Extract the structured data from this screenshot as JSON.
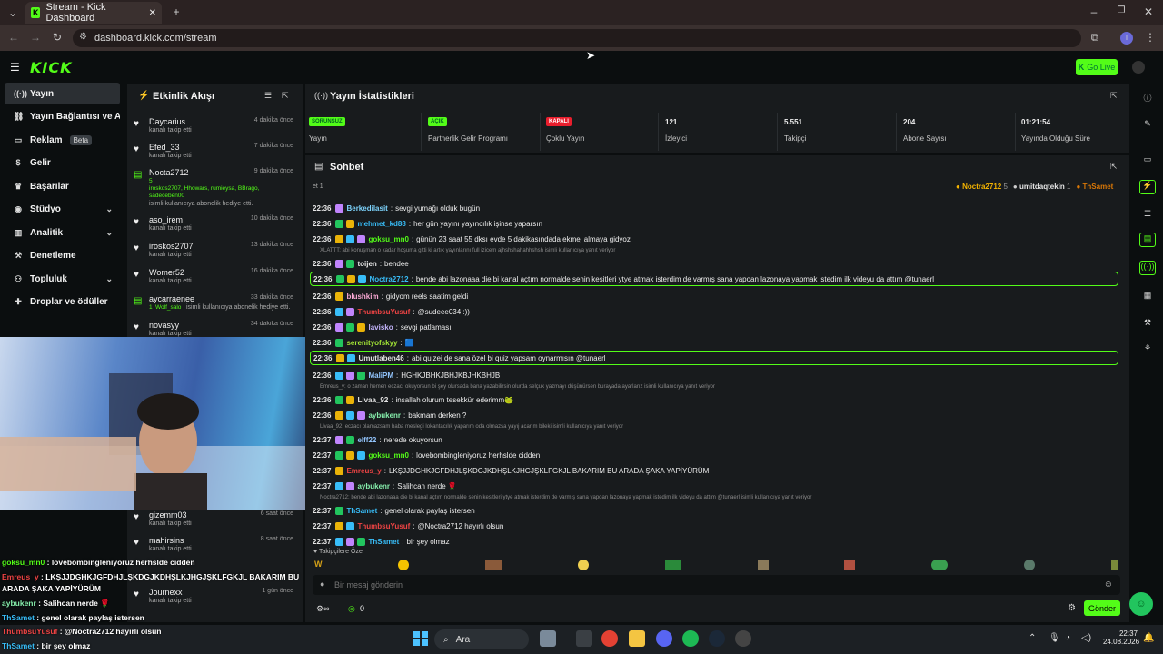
{
  "browser": {
    "tab_title": "Stream - Kick Dashboard",
    "url": "dashboard.kick.com/stream"
  },
  "header": {
    "logo": "KICK",
    "go_live": "Go Live"
  },
  "sidebar": {
    "items": [
      {
        "label": "Yayın",
        "icon": "stream-icon"
      },
      {
        "label": "Yayın Bağlantısı ve Anahtarı",
        "icon": "link-icon"
      },
      {
        "label": "Reklam",
        "badge": "Beta",
        "icon": "tv-icon"
      },
      {
        "label": "Gelir",
        "icon": "dollar-icon"
      },
      {
        "label": "Başarılar",
        "icon": "trophy-icon"
      },
      {
        "label": "Stüdyo",
        "icon": "studio-icon"
      },
      {
        "label": "Analitik",
        "icon": "chart-icon"
      },
      {
        "label": "Denetleme",
        "icon": "gavel-icon"
      },
      {
        "label": "Topluluk",
        "icon": "users-icon"
      },
      {
        "label": "Droplar ve ödüller",
        "icon": "gift-icon"
      }
    ]
  },
  "activity": {
    "title": "Etkinlik Akışı",
    "items": [
      {
        "name": "Daycarius",
        "time": "4 dakika önce",
        "desc": "kanalı takip etti"
      },
      {
        "name": "Efed_33",
        "time": "7 dakika önce",
        "desc": "kanalı takip etti"
      },
      {
        "name": "Nocta2712",
        "time": "9 dakika önce",
        "gift_count": "5",
        "gift_names": "iroskos2707, Hhowars, rumieysa, BBrago, sadeceben00",
        "desc": "isimli kullanıcıya abonelik hediye etti."
      },
      {
        "name": "aso_irem",
        "time": "10 dakika önce",
        "desc": "kanalı takip etti"
      },
      {
        "name": "iroskos2707",
        "time": "13 dakika önce",
        "desc": "kanalı takip etti"
      },
      {
        "name": "Womer52",
        "time": "16 dakika önce",
        "desc": "kanalı takip etti"
      },
      {
        "name": "aycarraenee",
        "time": "33 dakika önce",
        "gift_count": "1",
        "gift_names": "Wolf_salo",
        "desc": "isimli kullanıcıya abonelik hediye etti."
      },
      {
        "name": "novasyy",
        "time": "34 dakika önce",
        "desc": "kanalı takip etti"
      },
      {
        "name": "gizemm03",
        "time": "6 saat önce",
        "desc": "kanalı takip etti"
      },
      {
        "name": "mahirsins",
        "time": "8 saat önce",
        "desc": "kanalı takip etti"
      },
      {
        "name": "Journexx",
        "time": "1 gün önce",
        "desc": "kanalı takip etti"
      }
    ]
  },
  "stats": {
    "title": "Yayın İstatistikleri",
    "cells": [
      {
        "badge": "SORUNSUZ",
        "badge_color": "#53fc18",
        "label": "Yayın"
      },
      {
        "badge": "AÇIK",
        "badge_color": "#53fc18",
        "label": "Partnerlik Gelir Programı"
      },
      {
        "badge": "KAPALI",
        "badge_color": "#e91e2d",
        "label": "Çoklu Yayın"
      },
      {
        "value": "121",
        "label": "İzleyici"
      },
      {
        "value": "5.551",
        "label": "Takipçi"
      },
      {
        "value": "204",
        "label": "Abone Sayısı"
      },
      {
        "value": "01:21:54",
        "label": "Yayında Olduğu Süre"
      }
    ]
  },
  "chat": {
    "title": "Sohbet",
    "top_gifters": [
      {
        "name": "Noctra2712",
        "count": "5"
      },
      {
        "name": "umitdaqtekin",
        "count": "1"
      },
      {
        "name": "ThSamet",
        "count": ""
      }
    ],
    "top_left": "et 1",
    "messages": [
      {
        "time": "22:36",
        "user": "Berkedilasit",
        "color": "#7dd3fc",
        "text": "sevgi yumağı olduk bugün"
      },
      {
        "time": "22:36",
        "user": "mehmet_kd88",
        "color": "#38bdf8",
        "text": "her gün yayını yayıncılık işinse yaparsın"
      },
      {
        "time": "22:36",
        "user": "goksu_mn0",
        "color": "#53fc18",
        "text": "günün 23 saat 55 dksı evde 5 dakikasındada ekmej almaya gidyoz"
      },
      {
        "reply": "XLATTT: abi konuşman o kadar hoşuma gitti ki artık yayınlarını full izicem ajhshshahahhshsh isimli kullanıcıya yanıt veriyor"
      },
      {
        "time": "22:36",
        "user": "toijen",
        "color": "#e5e5e5",
        "text": "bendee"
      },
      {
        "time": "22:36",
        "user": "Noctra2712",
        "color": "#38bdf8",
        "text": "bende abi lazonaaa die bi kanal açtım normalde senin kesitleri ytye atmak isterdim de varmış sana yapoan lazonaya yapmak istedim ilk videyu da attım @tunaerl",
        "highlight": true
      },
      {
        "time": "22:36",
        "user": "blushkim",
        "color": "#f9a8d4",
        "text": "gidyom reels saatim geldi"
      },
      {
        "time": "22:36",
        "user": "ThumbsuYusuf",
        "color": "#ef4444",
        "text": "@sudeee034 :))"
      },
      {
        "time": "22:36",
        "user": "lavisko",
        "color": "#c4b5fd",
        "text": "sevgi patlaması"
      },
      {
        "time": "22:36",
        "user": "serenityofskyy",
        "color": "#a3e635",
        "text": "🟦"
      },
      {
        "time": "22:36",
        "user": "Umutlaben46",
        "color": "#e5e5e5",
        "text": "abi quizei de sana özel bi quiz yapsam oynarmısın @tunaerl",
        "highlight": true
      },
      {
        "time": "22:36",
        "user": "MaliPM",
        "color": "#93c5fd",
        "text": "HGHKJBHKJBHJKBJHKBHJB"
      },
      {
        "reply": "Emreus_y: o zaman hemen eczacı okuyorsun bi şey olursada bana yazabilirsin olurda selçuk yazmayı düşünürsen burayada ayarlarız isimli kullanıcıya yanıt veriyor"
      },
      {
        "time": "22:36",
        "user": "Livaa_92",
        "color": "#e5e5e5",
        "text": "insallah olurum tesekkür ederimm🐸"
      },
      {
        "time": "22:36",
        "user": "aybukenr",
        "color": "#86efac",
        "text": "bakmam derken ?"
      },
      {
        "reply": "Livaa_92: eczacı olamazsam baba meslegi lokantacılık yaparım oda olmazsa yayıj acarım bileki isimli kullanıcıya yanıt veriyor"
      },
      {
        "time": "22:37",
        "user": "elff22",
        "color": "#93c5fd",
        "text": "nerede okuyorsun"
      },
      {
        "time": "22:37",
        "user": "goksu_mn0",
        "color": "#53fc18",
        "text": "lovebombingleniyoruz herhslde cidden"
      },
      {
        "time": "22:37",
        "user": "Emreus_y",
        "color": "#ef4444",
        "text": "LKŞJJDGHKJGFDHJLŞKDGJKDHŞLKJHGJŞKLFGKJL BAKARIM BU ARADA ŞAKA YAPİYÜRÜM"
      },
      {
        "time": "22:37",
        "user": "aybukenr",
        "color": "#86efac",
        "text": "Salihcan nerde 🌹"
      },
      {
        "reply": "Noctra2712: bende abi lazonaaa die bi kanal açtım normalde senin kesitleri ytye atmak isterdim de varmış sana yapoan lazonaya yapmak istedim ilk videyu da attım @tunaerl isimli kullanıcıya yanıt veriyor"
      },
      {
        "time": "22:37",
        "user": "ThSamet",
        "color": "#38bdf8",
        "text": "genel olarak paylaş istersen"
      },
      {
        "time": "22:37",
        "user": "ThumbsuYusuf",
        "color": "#ef4444",
        "text": "@Noctra2712 hayırlı olsun"
      },
      {
        "time": "22:37",
        "user": "ThSamet",
        "color": "#38bdf8",
        "text": "bir şey olmaz"
      }
    ],
    "emote_bar_label": "Takipçilere Özel",
    "input_placeholder": "Bir mesaj gönderin",
    "points": "0",
    "send": "Gönder"
  },
  "overlay_chat": [
    {
      "user": "goksu_mn0",
      "color": "#53fc18",
      "text": "lovebombingleniyoruz herhslde cidden"
    },
    {
      "user": "Emreus_y",
      "color": "#ef4444",
      "text": "LKŞJJDGHKJGFDHJLŞKDGJKDHŞLKJHGJŞKLFGKJL BAKARIM BU"
    },
    {
      "user": "",
      "color": "#ffffff",
      "text": "ARADA ŞAKA YAPİYÜRÜM"
    },
    {
      "user": "aybukenr",
      "color": "#86efac",
      "text": "Salihcan nerde 🌹"
    },
    {
      "user": "ThSamet",
      "color": "#38bdf8",
      "text": "genel olarak paylaş istersen"
    },
    {
      "user": "ThumbsuYusuf",
      "color": "#ef4444",
      "text": "@Noctra2712 hayırlı olsun"
    },
    {
      "user": "ThSamet",
      "color": "#38bdf8",
      "text": "bir şey olmaz"
    }
  ],
  "taskbar": {
    "search": "Ara",
    "time": "22:37",
    "date": "24.08.2026"
  }
}
